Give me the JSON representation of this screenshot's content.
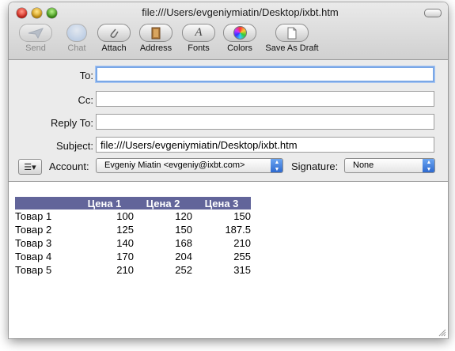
{
  "window": {
    "title": "file:///Users/evgeniymiatin/Desktop/ixbt.htm"
  },
  "toolbar": {
    "items": [
      {
        "label": "Send",
        "icon": "send-icon",
        "disabled": true
      },
      {
        "label": "Chat",
        "icon": "chat-icon",
        "disabled": true
      },
      {
        "label": "Attach",
        "icon": "paperclip-icon",
        "disabled": false
      },
      {
        "label": "Address",
        "icon": "address-book-icon",
        "disabled": false
      },
      {
        "label": "Fonts",
        "icon": "fonts-icon",
        "disabled": false
      },
      {
        "label": "Colors",
        "icon": "color-wheel-icon",
        "disabled": false
      },
      {
        "label": "Save As Draft",
        "icon": "draft-icon",
        "disabled": false
      }
    ]
  },
  "header": {
    "to_label": "To:",
    "to_value": "",
    "cc_label": "Cc:",
    "cc_value": "",
    "reply_to_label": "Reply To:",
    "reply_to_value": "",
    "subject_label": "Subject:",
    "subject_value": "file:///Users/evgeniymiatin/Desktop/ixbt.htm",
    "list_button": "☰▾",
    "account_label": "Account:",
    "account_value": "Evgeniy Miatin <evgeniy@ixbt.com>",
    "signature_label": "Signature:",
    "signature_value": "None"
  },
  "body": {
    "table": {
      "headers": [
        "",
        "Цена 1",
        "Цена 2",
        "Цена 3"
      ],
      "rows": [
        [
          "Товар 1",
          "100",
          "120",
          "150"
        ],
        [
          "Товар 2",
          "125",
          "150",
          "187.5"
        ],
        [
          "Товар 3",
          "140",
          "168",
          "210"
        ],
        [
          "Товар 4",
          "170",
          "204",
          "255"
        ],
        [
          "Товар 5",
          "210",
          "252",
          "315"
        ]
      ]
    }
  },
  "colors": {
    "table_header_bg": "#62659a",
    "focus_ring": "#7aa7e6",
    "popup_arrow": "#2a66cd"
  }
}
